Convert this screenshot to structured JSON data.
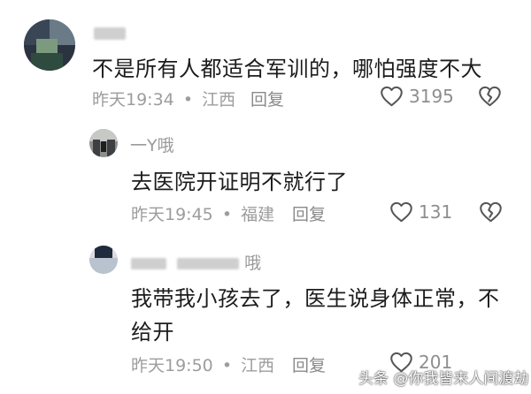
{
  "comments": [
    {
      "name": "",
      "text": "不是所有人都适合军训的，哪怕强度不大",
      "time": "昨天19:34",
      "location": "江西",
      "reply_label": "回复",
      "likes": "3195"
    },
    {
      "name": "一Y哦",
      "text": "去医院开证明不就行了",
      "time": "昨天19:45",
      "location": "福建",
      "reply_label": "回复",
      "likes": "131"
    },
    {
      "name": "哦",
      "text_line1": "我带我小孩去了，医生说身体正常，不",
      "text_line2": "给开",
      "time": "昨天19:50",
      "location": "江西",
      "reply_label": "回复",
      "likes": "201"
    }
  ],
  "separator": "•",
  "watermark": "头条 @你我皆来人间渡劫",
  "icons": {
    "like": "heart-outline-icon",
    "dislike": "broken-heart-icon"
  },
  "colors": {
    "text": "#1c1c1c",
    "meta": "#9d9d9d",
    "icon": "#555555"
  }
}
